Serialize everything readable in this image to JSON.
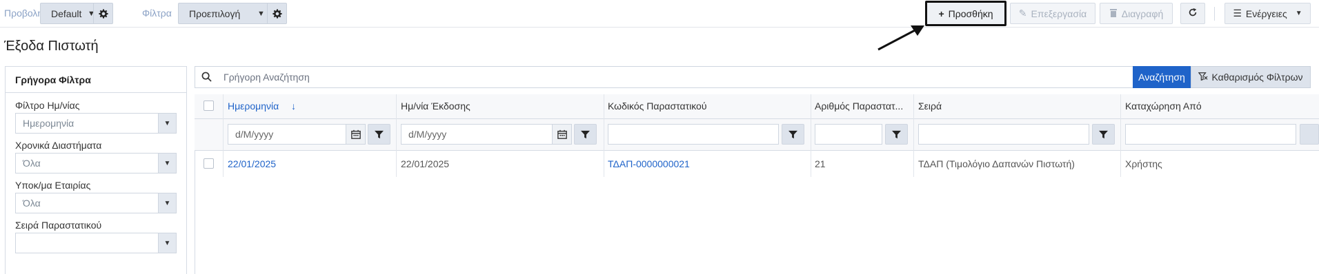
{
  "toolbar": {
    "view_label": "Προβολή",
    "view_value": "Default",
    "filters_label": "Φίλτρα",
    "filters_value": "Προεπιλογή",
    "add_label": "Προσθήκη",
    "edit_label": "Επεξεργασία",
    "delete_label": "Διαγραφή",
    "actions_label": "Ενέργειες"
  },
  "page": {
    "title": "Έξοδα Πιστωτή"
  },
  "quick_filters": {
    "title": "Γρήγορα Φίλτρα",
    "fields": [
      {
        "label": "Φίλτρο Ημ/νίας",
        "value": "Ημερομηνία"
      },
      {
        "label": "Χρονικά Διαστήματα",
        "value": "Όλα"
      },
      {
        "label": "Υποκ/μα Εταιρίας",
        "value": "Όλα"
      },
      {
        "label": "Σειρά Παραστατικού",
        "value": ""
      }
    ]
  },
  "search": {
    "placeholder": "Γρήγορη Αναζήτηση",
    "search_label": "Αναζήτηση",
    "clear_label": "Καθαρισμός Φίλτρων"
  },
  "grid": {
    "columns": [
      "Ημερομηνία",
      "Ημ/νία Έκδοσης",
      "Κωδικός Παραστατικού",
      "Αριθμός Παραστατ...",
      "Σειρά",
      "Καταχώρηση Από"
    ],
    "sort_indicator": "↓",
    "date_placeholder": "d/M/yyyy",
    "rows": [
      {
        "date": "22/01/2025",
        "issue_date": "22/01/2025",
        "code": "ΤΔΑΠ-0000000021",
        "number": "21",
        "series": "ΤΔΑΠ (Τιμολόγιο Δαπανών Πιστωτή)",
        "entered_by": "Χρήστης"
      }
    ]
  },
  "colors": {
    "accent": "#1f63c9",
    "button_bg": "#dde3ec",
    "border": "#d5dbe4"
  }
}
